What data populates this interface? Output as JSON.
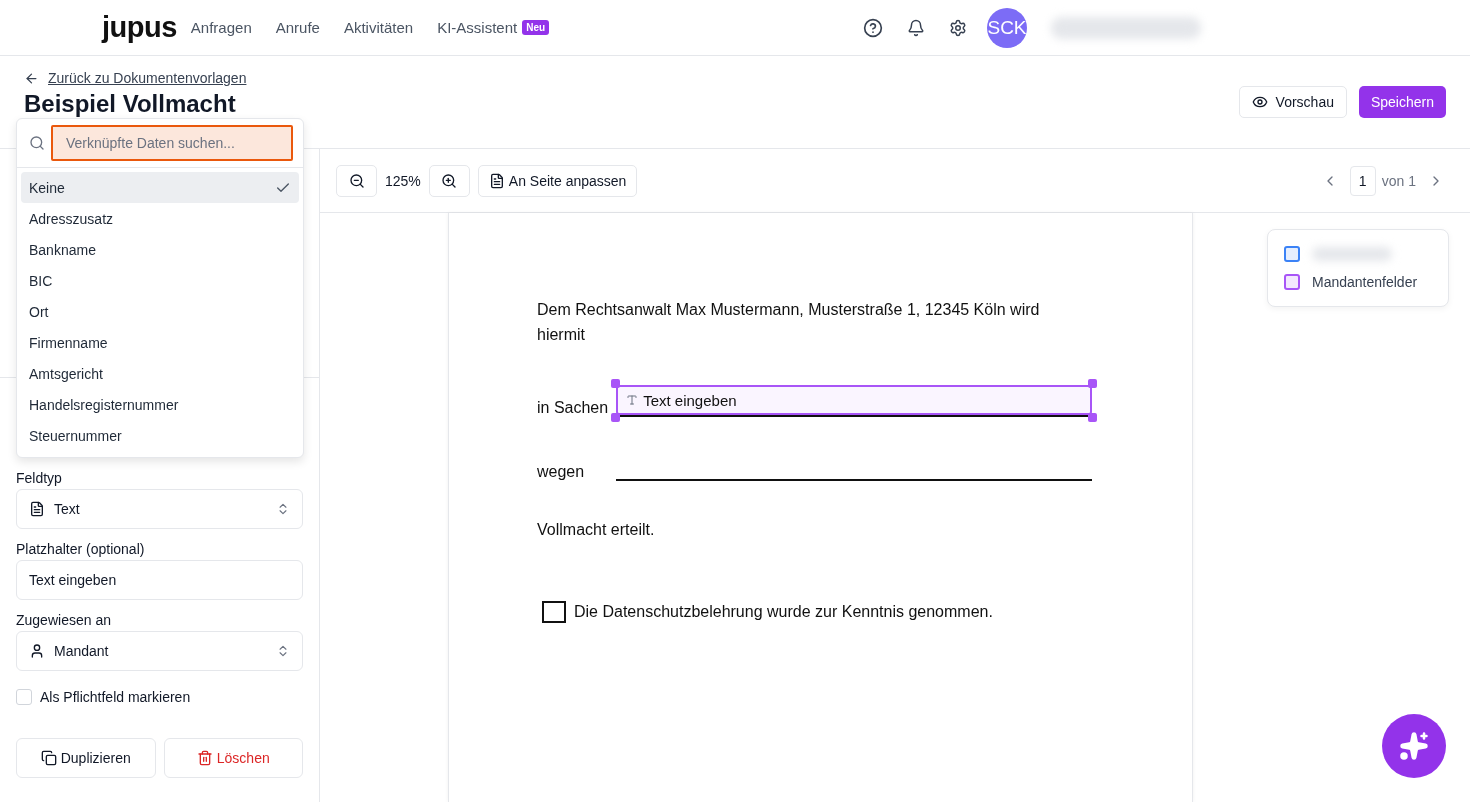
{
  "header": {
    "logo": "jupus",
    "nav": [
      {
        "label": "Anfragen"
      },
      {
        "label": "Anrufe"
      },
      {
        "label": "Aktivitäten"
      },
      {
        "label": "KI-Assistent",
        "badge": "Neu"
      }
    ],
    "avatar": "SCK"
  },
  "subheader": {
    "back_link": "Zurück zu Dokumentenvorlagen",
    "title": "Beispiel Vollmacht",
    "buttons": [
      {
        "label": "Vorschau",
        "kind": "secondary"
      },
      {
        "label": "Speichern",
        "kind": "primary"
      }
    ]
  },
  "dropdown": {
    "placeholder": "Verknüpfte Daten suchen...",
    "options": [
      {
        "label": "Keine",
        "selected": true
      },
      {
        "label": "Adresszusatz",
        "selected": false
      },
      {
        "label": "Bankname",
        "selected": false
      },
      {
        "label": "BIC",
        "selected": false
      },
      {
        "label": "Ort",
        "selected": false
      },
      {
        "label": "Firmenname",
        "selected": false
      },
      {
        "label": "Amtsgericht",
        "selected": false
      },
      {
        "label": "Handelsregisternummer",
        "selected": false
      },
      {
        "label": "Steuernummer",
        "selected": false
      }
    ]
  },
  "sidebar": {
    "fields": [
      {
        "label": "Feldtyp",
        "kind": "select",
        "value": "Text"
      },
      {
        "label": "Platzhalter (optional)",
        "kind": "input",
        "value": "Text eingeben"
      },
      {
        "label": "Zugewiesen an",
        "kind": "select",
        "value": "Mandant"
      }
    ],
    "required": {
      "label": "Als Pflichtfeld markieren",
      "checked": false
    },
    "actions": [
      {
        "label": "Duplizieren",
        "kind": "neutral"
      },
      {
        "label": "Löschen",
        "kind": "danger"
      }
    ]
  },
  "toolbar": {
    "zoom": "125%",
    "fit": "An Seite anpassen",
    "page": "1",
    "page_total": "von 1"
  },
  "legend": [
    {
      "color": "#3b82f6"
    },
    {
      "label": "Mandantenfelder",
      "color": "#a855f7"
    }
  ],
  "document": {
    "intro": "Dem Rechtsanwalt Max Mustermann, Musterstraße 1, 12345 Köln wird hiermit",
    "lines": [
      {
        "label": "in Sachen",
        "field": "Text eingeben",
        "selected": true
      },
      {
        "label": "wegen",
        "selected": false
      }
    ],
    "closing": "Vollmacht erteilt.",
    "checkbox": {
      "label": "Die Datenschutzbelehrung wurde zur Kenntnis genommen.",
      "checked": false
    }
  }
}
